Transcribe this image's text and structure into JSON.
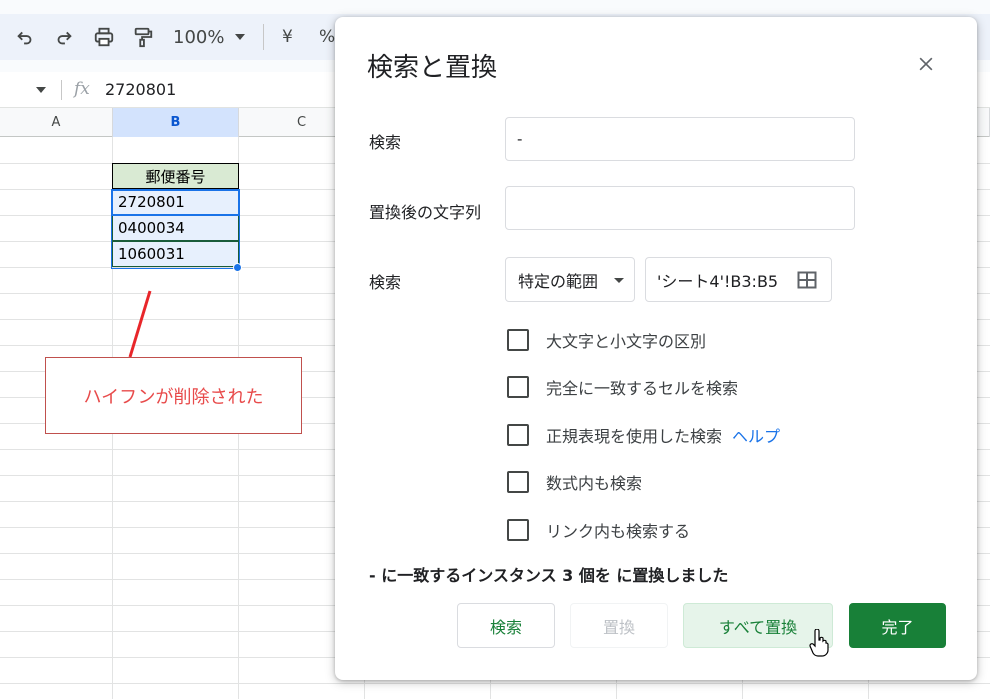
{
  "toolbar": {
    "zoom": "100%",
    "currency_symbol": "¥",
    "percent_symbol": "%",
    "icons": [
      "undo-icon",
      "redo-icon",
      "print-icon",
      "paint-format-icon"
    ]
  },
  "formula_bar": {
    "fx": "fx",
    "value": "2720801"
  },
  "sheet": {
    "columns": [
      "A",
      "B",
      "C"
    ],
    "header_cell": "郵便番号",
    "data_cells": [
      "2720801",
      "0400034",
      "1060031"
    ],
    "header_color": "#d9ead3",
    "selection_color": "#1a73e8"
  },
  "annotation": {
    "text": "ハイフンが削除された",
    "color": "#e84b4b"
  },
  "dialog": {
    "title": "検索と置換",
    "find_label": "検索",
    "find_value": "-",
    "replace_label": "置換後の文字列",
    "replace_value": "",
    "search_label": "検索",
    "scope_select": "特定の範囲",
    "range_value": "'シート4'!B3:B5",
    "options": [
      {
        "label": "大文字と小文字の区別",
        "checked": false
      },
      {
        "label": "完全に一致するセルを検索",
        "checked": false
      },
      {
        "label": "正規表現を使用した検索",
        "checked": false,
        "help": "ヘルプ"
      },
      {
        "label": "数式内も検索",
        "checked": false
      },
      {
        "label": "リンク内も検索する",
        "checked": false
      }
    ],
    "status": "- に一致するインスタンス 3 個を に置換しました",
    "buttons": {
      "search": "検索",
      "replace": "置換",
      "replace_all": "すべて置換",
      "done": "完了"
    },
    "accent_color": "#188038"
  }
}
